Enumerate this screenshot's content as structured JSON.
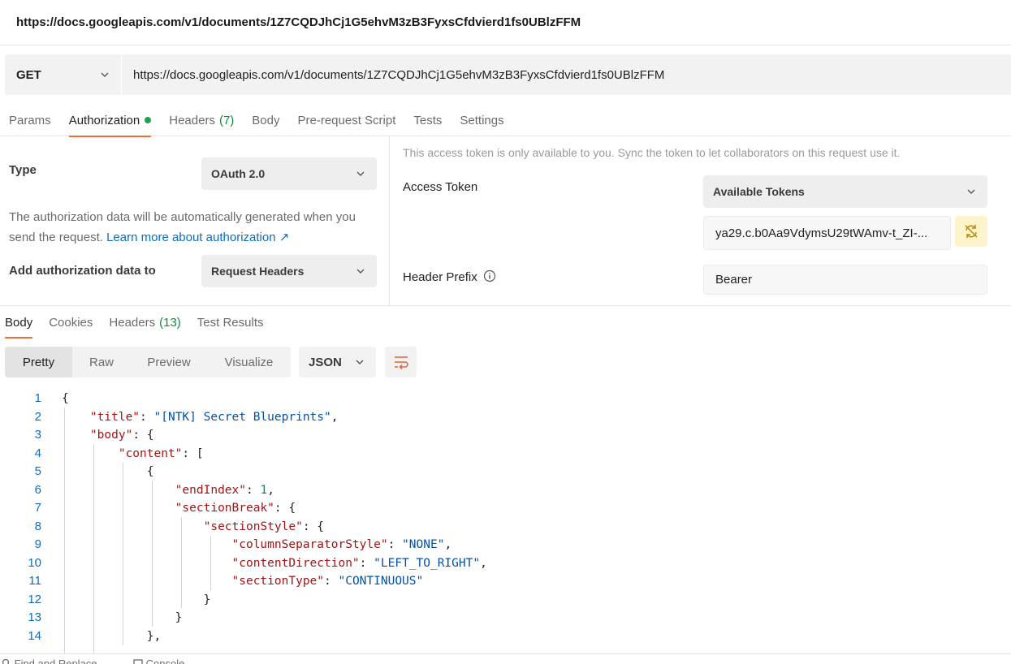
{
  "window": {
    "title": "https://docs.googleapis.com/v1/documents/1Z7CQDJhCj1G5ehvM3zB3FyxsCfdvierd1fs0UBlzFFM"
  },
  "request": {
    "method": "GET",
    "url": "https://docs.googleapis.com/v1/documents/1Z7CQDJhCj1G5ehvM3zB3FyxsCfdvierd1fs0UBlzFFM"
  },
  "request_tabs": [
    {
      "label": "Params",
      "count": ""
    },
    {
      "label": "Authorization",
      "count": ""
    },
    {
      "label": "Headers",
      "count": "(7)"
    },
    {
      "label": "Body",
      "count": ""
    },
    {
      "label": "Pre-request Script",
      "count": ""
    },
    {
      "label": "Tests",
      "count": ""
    },
    {
      "label": "Settings",
      "count": ""
    }
  ],
  "auth": {
    "type_label": "Type",
    "type_value": "OAuth 2.0",
    "description": "The authorization data will be automatically generated when you send the request.",
    "learn_more": "Learn more about authorization ↗",
    "add_to_label": "Add authorization data to",
    "add_to_value": "Request Headers",
    "note": "This access token is only available to you. Sync the token to let collaborators on this request use it.",
    "access_token_label": "Access Token",
    "available_tokens": "Available Tokens",
    "token_value": "ya29.c.b0Aa9VdymsU29tWAmv-t_ZI-...",
    "header_prefix_label": "Header Prefix",
    "header_prefix_value": "Bearer"
  },
  "response_tabs": [
    {
      "label": "Body",
      "count": ""
    },
    {
      "label": "Cookies",
      "count": ""
    },
    {
      "label": "Headers",
      "count": "(13)"
    },
    {
      "label": "Test Results",
      "count": ""
    }
  ],
  "view_modes": [
    "Pretty",
    "Raw",
    "Preview",
    "Visualize"
  ],
  "format": "JSON",
  "code_lines": [
    "1",
    "2",
    "3",
    "4",
    "5",
    "6",
    "7",
    "8",
    "9",
    "10",
    "11",
    "12",
    "13",
    "14"
  ],
  "code": {
    "title_key": "\"title\"",
    "title_val": "\"[NTK] Secret Blueprints\"",
    "body_key": "\"body\"",
    "content_key": "\"content\"",
    "endIndex_key": "\"endIndex\"",
    "endIndex_val": "1",
    "sectionBreak_key": "\"sectionBreak\"",
    "sectionStyle_key": "\"sectionStyle\"",
    "colSep_key": "\"columnSeparatorStyle\"",
    "colSep_val": "\"NONE\"",
    "contentDir_key": "\"contentDirection\"",
    "contentDir_val": "\"LEFT_TO_RIGHT\"",
    "sectionType_key": "\"sectionType\"",
    "sectionType_val": "\"CONTINUOUS\""
  },
  "footer": {
    "find_replace": "Find and Replace",
    "console": "Console"
  },
  "colors": {
    "accent": "#f26b3a",
    "success": "#1fa34a",
    "link": "#0d6ebf"
  }
}
